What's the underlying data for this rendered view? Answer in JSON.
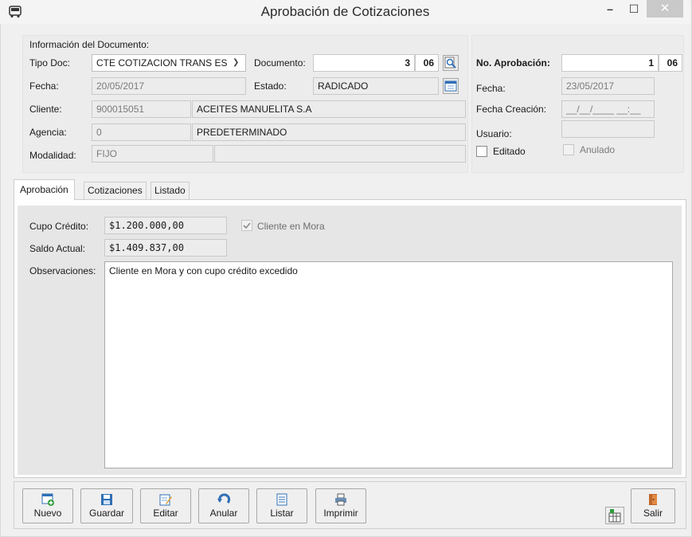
{
  "window": {
    "title": "Aprobación de Cotizaciones",
    "min": "–",
    "max": "☐",
    "close": "✕"
  },
  "doc": {
    "section_title": "Información del Documento:",
    "tipo_doc_label": "Tipo Doc:",
    "tipo_doc_value": "CTE COTIZACION TRANS ES",
    "documento_label": "Documento:",
    "documento_number": "3",
    "documento_prefix": "06",
    "fecha_label": "Fecha:",
    "fecha_value": "20/05/2017",
    "estado_label": "Estado:",
    "estado_value": "RADICADO",
    "cliente_label": "Cliente:",
    "cliente_id": "900015051",
    "cliente_name": "ACEITES MANUELITA S.A",
    "agencia_label": "Agencia:",
    "agencia_id": "0",
    "agencia_name": "PREDETERMINADO",
    "modalidad_label": "Modalidad:",
    "modalidad_value": "FIJO",
    "modalidad_extra": ""
  },
  "approval": {
    "numero_label": "No. Aprobación:",
    "numero_value": "1",
    "numero_prefix": "06",
    "fecha_label": "Fecha:",
    "fecha_value": "23/05/2017",
    "fecha_creacion_label": "Fecha Creación:",
    "fecha_creacion_value": "__/__/____ __:__",
    "usuario_label": "Usuario:",
    "usuario_value": "",
    "editado_label": "Editado",
    "editado_checked": false,
    "anulado_label": "Anulado",
    "anulado_checked": false
  },
  "tabs": [
    {
      "label": "Aprobación",
      "active": true
    },
    {
      "label": "Cotizaciones",
      "active": false
    },
    {
      "label": "Listado",
      "active": false
    }
  ],
  "aprobacion_tab": {
    "cupo_label": "Cupo Crédito:",
    "cupo_value": "$1.200.000,00",
    "saldo_label": "Saldo Actual:",
    "saldo_value": "$1.409.837,00",
    "mora_label": "Cliente en Mora",
    "mora_checked": true,
    "obs_label": "Observaciones:",
    "obs_value": "Cliente en Mora y con cupo crédito excedido"
  },
  "toolbar": {
    "nuevo": "Nuevo",
    "guardar": "Guardar",
    "editar": "Editar",
    "anular": "Anular",
    "listar": "Listar",
    "imprimir": "Imprimir",
    "salir": "Salir"
  },
  "colors": {
    "accent_blue": "#2f6fb5",
    "green": "#2e9b3a",
    "close_gray": "#c9c9c9"
  },
  "icons": {
    "app": "bus-icon",
    "search": "magnifier-icon",
    "calendar": "calendar-icon",
    "nuevo": "new-doc-icon",
    "guardar": "save-icon",
    "editar": "edit-icon",
    "anular": "undo-icon",
    "listar": "list-icon",
    "imprimir": "printer-icon",
    "extra": "grid-tool-icon",
    "salir": "exit-door-icon"
  }
}
